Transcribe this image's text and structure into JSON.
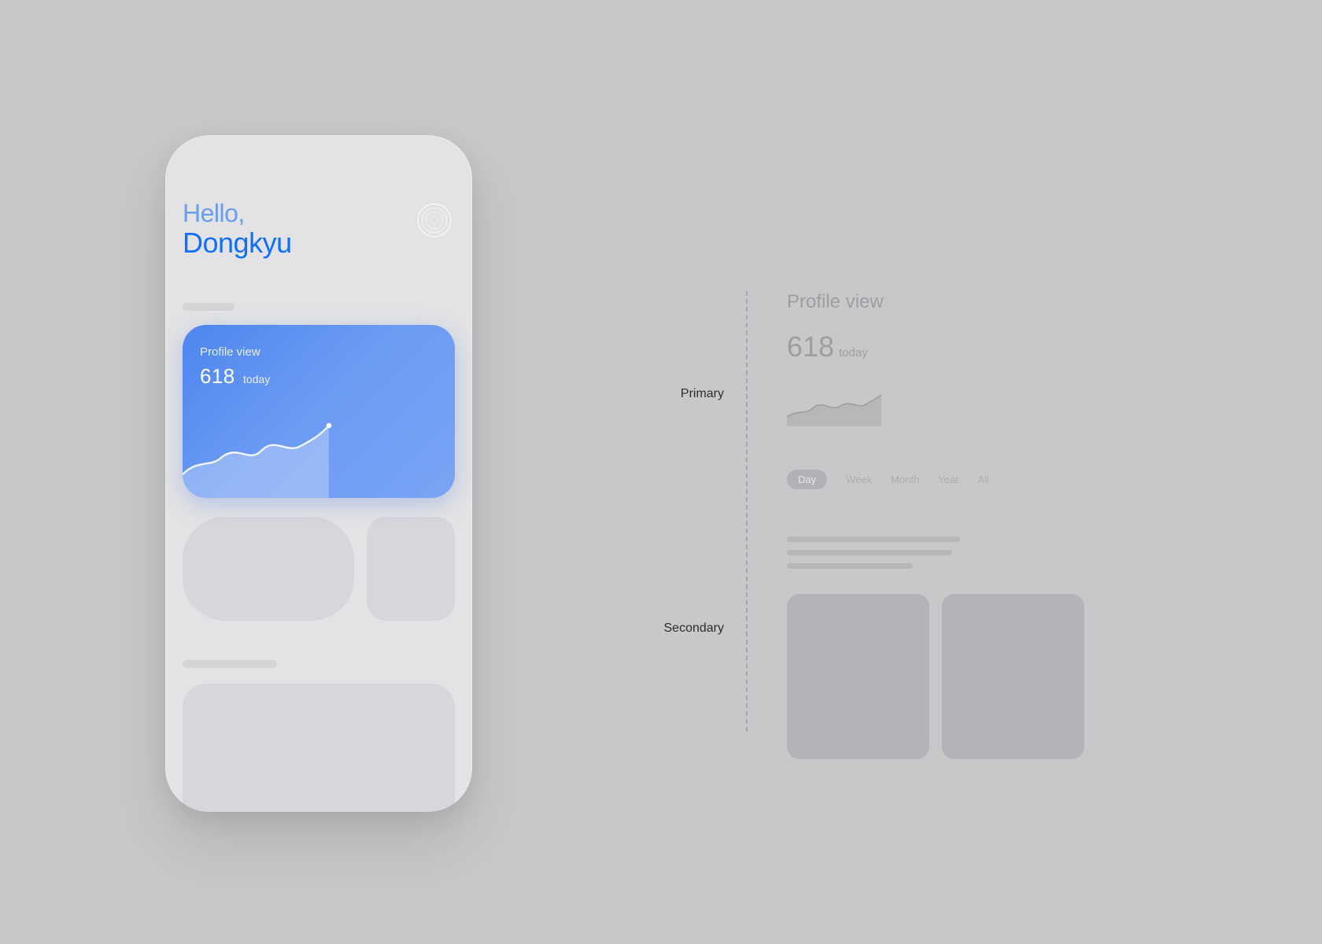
{
  "phone": {
    "greeting_prefix": "Hello,",
    "user_name": "Dongkyu",
    "card": {
      "label": "Profile view",
      "value": "618",
      "qualifier": "today"
    }
  },
  "annotation": {
    "primary_label": "Primary",
    "secondary_label": "Secondary",
    "preview": {
      "title": "Profile view",
      "value": "618",
      "qualifier": "today",
      "tabs": [
        "Day",
        "Week",
        "Month",
        "Year",
        "All"
      ],
      "active_tab": "Day"
    }
  },
  "chart_data": {
    "type": "line",
    "title": "Profile view",
    "categories": [
      "",
      "",
      "",
      "",
      "",
      "",
      ""
    ],
    "values": [
      45,
      60,
      50,
      62,
      66,
      58,
      78
    ],
    "ylim": [
      0,
      100
    ],
    "xlabel": "",
    "ylabel": "",
    "note": "values estimated from unlabeled sparkline"
  }
}
